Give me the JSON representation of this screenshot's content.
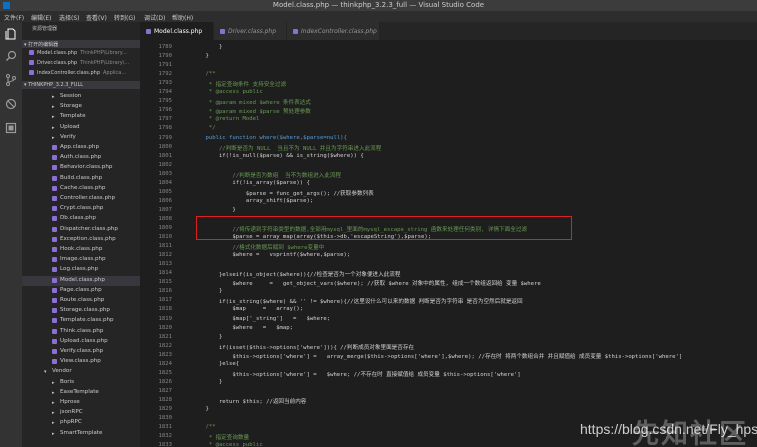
{
  "window": {
    "title": "Model.class.php — thinkphp_3.2.3_full — Visual Studio Code"
  },
  "menu": [
    {
      "label": "文件(F)"
    },
    {
      "label": "编辑(E)"
    },
    {
      "label": "选择(S)"
    },
    {
      "label": "查看(V)"
    },
    {
      "label": "转到(G)"
    },
    {
      "label": "调试(D)"
    },
    {
      "label": "帮助(H)"
    }
  ],
  "activity_bar": [
    {
      "icon": "files-icon"
    },
    {
      "icon": "search-icon"
    },
    {
      "icon": "source-control-icon"
    },
    {
      "icon": "debug-icon"
    },
    {
      "icon": "extensions-icon"
    }
  ],
  "sidebar": {
    "header": "资源管理器",
    "open_editors_title": "▾ 打开的编辑器",
    "open_editors": [
      {
        "name": "Model.class.php",
        "path": "ThinkPHP\\Library..."
      },
      {
        "name": "Driver.class.php",
        "path": "ThinkPHP\\Library\\..."
      },
      {
        "name": "IndexController.class.php",
        "path": "Applica..."
      }
    ],
    "project_title": "▾ THINKPHP_3.2.3_FULL",
    "tree": [
      {
        "label": "Session",
        "kind": "folder",
        "depth": 1
      },
      {
        "label": "Storage",
        "kind": "folder",
        "depth": 1
      },
      {
        "label": "Template",
        "kind": "folder",
        "depth": 1
      },
      {
        "label": "Upload",
        "kind": "folder",
        "depth": 1
      },
      {
        "label": "Verify",
        "kind": "folder",
        "depth": 1
      },
      {
        "label": "App.class.php",
        "kind": "file",
        "depth": 1
      },
      {
        "label": "Auth.class.php",
        "kind": "file",
        "depth": 1
      },
      {
        "label": "Behavior.class.php",
        "kind": "file",
        "depth": 1
      },
      {
        "label": "Build.class.php",
        "kind": "file",
        "depth": 1
      },
      {
        "label": "Cache.class.php",
        "kind": "file",
        "depth": 1
      },
      {
        "label": "Controller.class.php",
        "kind": "file",
        "depth": 1
      },
      {
        "label": "Crypt.class.php",
        "kind": "file",
        "depth": 1
      },
      {
        "label": "Db.class.php",
        "kind": "file",
        "depth": 1
      },
      {
        "label": "Dispatcher.class.php",
        "kind": "file",
        "depth": 1
      },
      {
        "label": "Exception.class.php",
        "kind": "file",
        "depth": 1
      },
      {
        "label": "Hook.class.php",
        "kind": "file",
        "depth": 1
      },
      {
        "label": "Image.class.php",
        "kind": "file",
        "depth": 1
      },
      {
        "label": "Log.class.php",
        "kind": "file",
        "depth": 1
      },
      {
        "label": "Model.class.php",
        "kind": "file",
        "depth": 1,
        "active": true
      },
      {
        "label": "Page.class.php",
        "kind": "file",
        "depth": 1
      },
      {
        "label": "Route.class.php",
        "kind": "file",
        "depth": 1
      },
      {
        "label": "Storage.class.php",
        "kind": "file",
        "depth": 1
      },
      {
        "label": "Template.class.php",
        "kind": "file",
        "depth": 1
      },
      {
        "label": "Think.class.php",
        "kind": "file",
        "depth": 1
      },
      {
        "label": "Upload.class.php",
        "kind": "file",
        "depth": 1
      },
      {
        "label": "Verify.class.php",
        "kind": "file",
        "depth": 1
      },
      {
        "label": "View.class.php",
        "kind": "file",
        "depth": 1
      },
      {
        "label": "Vendor",
        "kind": "folder-open",
        "depth": 0
      },
      {
        "label": "Boris",
        "kind": "folder",
        "depth": 1
      },
      {
        "label": "EaseTemplate",
        "kind": "folder",
        "depth": 1
      },
      {
        "label": "Hprose",
        "kind": "folder",
        "depth": 1
      },
      {
        "label": "jsonRPC",
        "kind": "folder",
        "depth": 1
      },
      {
        "label": "phpRPC",
        "kind": "folder",
        "depth": 1
      },
      {
        "label": "SmartTemplate",
        "kind": "folder",
        "depth": 1
      }
    ]
  },
  "tabs": [
    {
      "label": "Model.class.php",
      "active": true
    },
    {
      "label": "Driver.class.php",
      "active": false
    },
    {
      "label": "IndexController.class.php",
      "active": false
    }
  ],
  "editor": {
    "lines": [
      {
        "n": "1789",
        "text": "        }",
        "kind": "plain"
      },
      {
        "n": "1790",
        "text": "    }",
        "kind": "plain"
      },
      {
        "n": "1791",
        "text": "",
        "kind": "plain"
      },
      {
        "n": "1792",
        "text": "    /**",
        "kind": "comment"
      },
      {
        "n": "1793",
        "text": "     * 指定查询条件 支持安全过滤",
        "kind": "comment"
      },
      {
        "n": "1794",
        "text": "     * @access public",
        "kind": "comment"
      },
      {
        "n": "1795",
        "text": "     * @param mixed $where 条件表达式",
        "kind": "comment"
      },
      {
        "n": "1796",
        "text": "     * @param mixed $parse 预处理参数",
        "kind": "comment"
      },
      {
        "n": "1797",
        "text": "     * @return Model",
        "kind": "comment"
      },
      {
        "n": "1798",
        "text": "     */",
        "kind": "comment"
      },
      {
        "n": "1799",
        "text": "    public function where($where,$parse=null){",
        "kind": "keyword"
      },
      {
        "n": "1800",
        "text": "        //判断是否为 NULL  当且不为 NULL 并且为字符串进入此流程",
        "kind": "comment"
      },
      {
        "n": "1801",
        "text": "        if(!is_null($parse) && is_string($where)) {",
        "kind": "plain"
      },
      {
        "n": "1802",
        "text": "",
        "kind": "plain"
      },
      {
        "n": "1803",
        "text": "            //判断是否为数组  当不为数组进入此流程",
        "kind": "comment"
      },
      {
        "n": "1804",
        "text": "            if(!is_array($parse)) {",
        "kind": "plain"
      },
      {
        "n": "1805",
        "text": "                $parse = func_get_args(); //获取参数列表",
        "kind": "plain"
      },
      {
        "n": "1806",
        "text": "                array_shift($parse);",
        "kind": "plain"
      },
      {
        "n": "1807",
        "text": "            }",
        "kind": "plain"
      },
      {
        "n": "1808",
        "text": "",
        "kind": "plain"
      },
      {
        "n": "1809",
        "text": "            //将传递到字符串类型的数据,全部用mysql_里面的mysql_escape_string 函数来处理任何类别, 详情下面全过滤",
        "kind": "comment"
      },
      {
        "n": "1810",
        "text": "            $parse = array_map(array($this->db,'escapeString'),$parse);",
        "kind": "plain"
      },
      {
        "n": "1811",
        "text": "            //格式化数据后赋到 $where变量中",
        "kind": "comment"
      },
      {
        "n": "1812",
        "text": "            $where =   vsprintf($where,$parse);",
        "kind": "plain"
      },
      {
        "n": "1813",
        "text": "",
        "kind": "plain"
      },
      {
        "n": "1814",
        "text": "        }elseif(is_object($where)){//检查是否为一个对象便进入此流程",
        "kind": "plain"
      },
      {
        "n": "1815",
        "text": "            $where     =   get_object_vars($where); //获取 $where 对象中的属性, 组成一个数组返回给 变量 $where",
        "kind": "plain"
      },
      {
        "n": "1816",
        "text": "        }",
        "kind": "plain"
      },
      {
        "n": "1817",
        "text": "        if(is_string($where) && '' != $where){//这里设什么可以来的数据 判断是否为字符串 是否为空然后就是返回",
        "kind": "plain"
      },
      {
        "n": "1818",
        "text": "            $map     =   array();",
        "kind": "plain"
      },
      {
        "n": "1819",
        "text": "            $map['_string']   =   $where;",
        "kind": "plain"
      },
      {
        "n": "1820",
        "text": "            $where   =   $map;",
        "kind": "plain"
      },
      {
        "n": "1821",
        "text": "        }",
        "kind": "plain"
      },
      {
        "n": "1822",
        "text": "        if(isset($this->options['where'])){ //判断成员对象里面是否存在",
        "kind": "plain"
      },
      {
        "n": "1823",
        "text": "            $this->options['where'] =   array_merge($this->options['where'],$where); //存在时 将两个数组合并 并且赋值给 成员变量 $this->options['where']",
        "kind": "plain"
      },
      {
        "n": "1824",
        "text": "        }else{",
        "kind": "plain"
      },
      {
        "n": "1825",
        "text": "            $this->options['where'] =   $where; //不存在时 直接赋值给 成员变量 $this->options['where']",
        "kind": "plain"
      },
      {
        "n": "1826",
        "text": "        }",
        "kind": "plain"
      },
      {
        "n": "1827",
        "text": "",
        "kind": "plain"
      },
      {
        "n": "1828",
        "text": "        return $this; //返回当前内容",
        "kind": "plain"
      },
      {
        "n": "1829",
        "text": "    }",
        "kind": "plain"
      },
      {
        "n": "1830",
        "text": "",
        "kind": "plain"
      },
      {
        "n": "1831",
        "text": "    /**",
        "kind": "comment"
      },
      {
        "n": "1832",
        "text": "     * 指定查询数量",
        "kind": "comment"
      },
      {
        "n": "1833",
        "text": "     * @access public",
        "kind": "comment"
      }
    ]
  },
  "watermark": "https://blog.csdn.net/Fly_hps",
  "seal_text": "先知社区"
}
